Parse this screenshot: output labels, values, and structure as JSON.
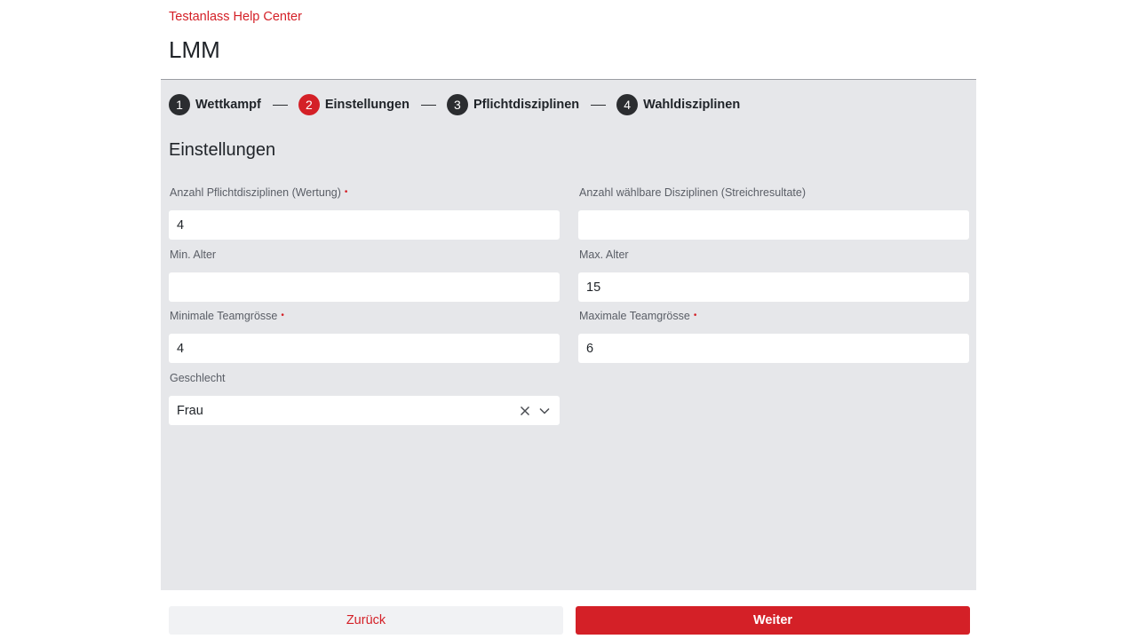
{
  "header": {
    "breadcrumb": "Testanlass Help Center",
    "title": "LMM"
  },
  "stepper": {
    "steps": [
      {
        "number": "1",
        "label": "Wettkampf",
        "active": false
      },
      {
        "number": "2",
        "label": "Einstellungen",
        "active": true
      },
      {
        "number": "3",
        "label": "Pflichtdisziplinen",
        "active": false
      },
      {
        "number": "4",
        "label": "Wahldisziplinen",
        "active": false
      }
    ]
  },
  "form": {
    "section_title": "Einstellungen",
    "required_marker": "•",
    "fields": {
      "pflicht_count": {
        "label": "Anzahl Pflichtdisziplinen (Wertung)",
        "value": "4",
        "required": true
      },
      "wahl_count": {
        "label": "Anzahl wählbare Disziplinen (Streichresultate)",
        "value": "",
        "required": false
      },
      "min_age": {
        "label": "Min. Alter",
        "value": "",
        "required": false
      },
      "max_age": {
        "label": "Max. Alter",
        "value": "15",
        "required": false
      },
      "min_team": {
        "label": "Minimale Teamgrösse",
        "value": "4",
        "required": true
      },
      "max_team": {
        "label": "Maximale Teamgrösse",
        "value": "6",
        "required": true
      },
      "gender": {
        "label": "Geschlecht",
        "value": "Frau",
        "required": false
      }
    }
  },
  "actions": {
    "back_label": "Zurück",
    "next_label": "Weiter"
  },
  "colors": {
    "accent": "#d42027",
    "panel_bg": "#e6e7ea",
    "step_dark": "#2b2d30"
  },
  "icons": {
    "clear": "close-icon",
    "dropdown": "chevron-down-icon"
  }
}
